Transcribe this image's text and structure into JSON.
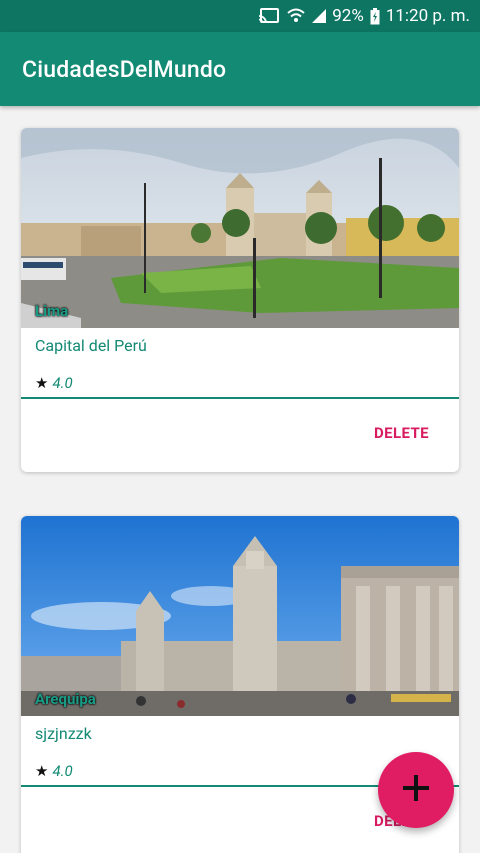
{
  "status_bar": {
    "battery": "92%",
    "time": "11:20 p. m."
  },
  "app_bar": {
    "title": "CiudadesDelMundo"
  },
  "cards": [
    {
      "image_caption": "Lima",
      "description": "Capital del Perú",
      "rating": "4.0",
      "delete_label": "DELETE"
    },
    {
      "image_caption": "Arequipa",
      "description": "sjzjnzzk",
      "rating": "4.0",
      "delete_label": "DELETE"
    }
  ],
  "fab": {
    "icon": "plus-icon"
  },
  "colors": {
    "primary": "#138a74",
    "primary_dark": "#0e7563",
    "accent": "#e01c63",
    "delete_text": "#d81b60"
  }
}
